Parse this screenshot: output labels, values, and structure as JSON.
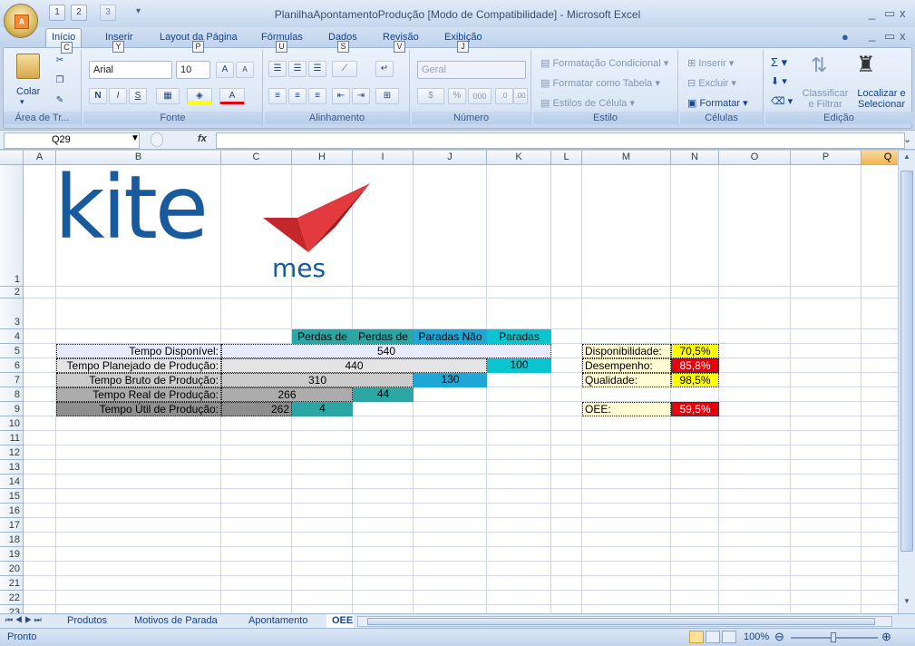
{
  "window": {
    "title": "PlanilhaApontamentoProdução  [Modo de Compatibilidade] - Microsoft Excel",
    "minimize": "_",
    "restore": "▭",
    "close": "x"
  },
  "office_button": {
    "label": "A"
  },
  "qat": {
    "save_key": "1",
    "undo_key": "2",
    "redo_key": "3",
    "dropdown": "▾"
  },
  "tabs": [
    {
      "label": "Início",
      "key": "C"
    },
    {
      "label": "Inserir",
      "key": "Y"
    },
    {
      "label": "Layout da Página",
      "key": "P"
    },
    {
      "label": "Fórmulas",
      "key": "U"
    },
    {
      "label": "Dados",
      "key": "S"
    },
    {
      "label": "Revisão",
      "key": "V"
    },
    {
      "label": "Exibição",
      "key": "J"
    }
  ],
  "ribbon": {
    "clipboard": {
      "title": "Área de Tr...",
      "paste": "Colar"
    },
    "font": {
      "title": "Fonte",
      "name": "Arial",
      "size": "10",
      "bold": "N",
      "italic": "I",
      "underline": "S",
      "grow": "A",
      "shrink": "A"
    },
    "alignment": {
      "title": "Alinhamento"
    },
    "number": {
      "title": "Número",
      "format": "Geral",
      "percent": "%",
      "thousands": "000"
    },
    "style": {
      "title": "Estilo",
      "conditional": "Formatação Condicional",
      "table": "Formatar como Tabela",
      "cell_styles": "Estilos de Célula"
    },
    "cells": {
      "title": "Células",
      "insert": "Inserir",
      "delete": "Excluir",
      "format": "Formatar"
    },
    "editing": {
      "title": "Edição",
      "sort": "Classificar e Filtrar",
      "find": "Localizar e Selecionar",
      "sum": "Σ"
    }
  },
  "formula_bar": {
    "name_box": "Q29",
    "fx": "fx",
    "formula": ""
  },
  "columns": [
    "A",
    "B",
    "C",
    "H",
    "I",
    "J",
    "K",
    "L",
    "M",
    "N",
    "O",
    "P",
    "Q"
  ],
  "rows": [
    "1",
    "2",
    "3",
    "4",
    "5",
    "6",
    "7",
    "8",
    "9",
    "10",
    "11",
    "12",
    "13",
    "14",
    "15",
    "16",
    "17",
    "18",
    "19",
    "20",
    "21",
    "22",
    "23"
  ],
  "logo": {
    "word": "kite",
    "sub": "mes"
  },
  "headers": {
    "qualidade": "Perdas de Qualidade",
    "eficiencia": "Perdas de Eficiência",
    "nao_planejadas": "Paradas Não Planejadas",
    "planejadas": "Paradas Planejadas"
  },
  "table": {
    "disponivel_label": "Tempo Disponível:",
    "disponivel_val": "540",
    "planejado_label": "Tempo Planejado de Produção:",
    "planejado_val": "440",
    "planejadas_val": "100",
    "bruto_label": "Tempo Bruto de Produção:",
    "bruto_val": "310",
    "nao_planejadas_val": "130",
    "real_label": "Tempo Real de Produção:",
    "real_val": "266",
    "eficiencia_val": "44",
    "util_label": "Tempo Útil de Produção:",
    "util_val": "262",
    "qualidade_val": "4"
  },
  "kpis": {
    "disponibilidade_label": "Disponibilidade:",
    "disponibilidade_val": "70,5%",
    "desempenho_label": "Desempenho:",
    "desempenho_val": "85,8%",
    "qualidade_label": "Qualidade:",
    "qualidade_val": "98,5%",
    "oee_label": "OEE:",
    "oee_val": "59,5%"
  },
  "sheets": [
    "Produtos",
    "Motivos de Parada",
    "Apontamento",
    "OEE"
  ],
  "status": {
    "ready": "Pronto",
    "zoom": "100%"
  },
  "colors": {
    "teal": "#2ca6a4",
    "blue": "#1fa7d6",
    "cyan": "#0ac5d0",
    "yellow": "#ffff00",
    "red": "#e8000a",
    "logo_blue": "#175a9d",
    "logo_red": "#c4272b"
  }
}
